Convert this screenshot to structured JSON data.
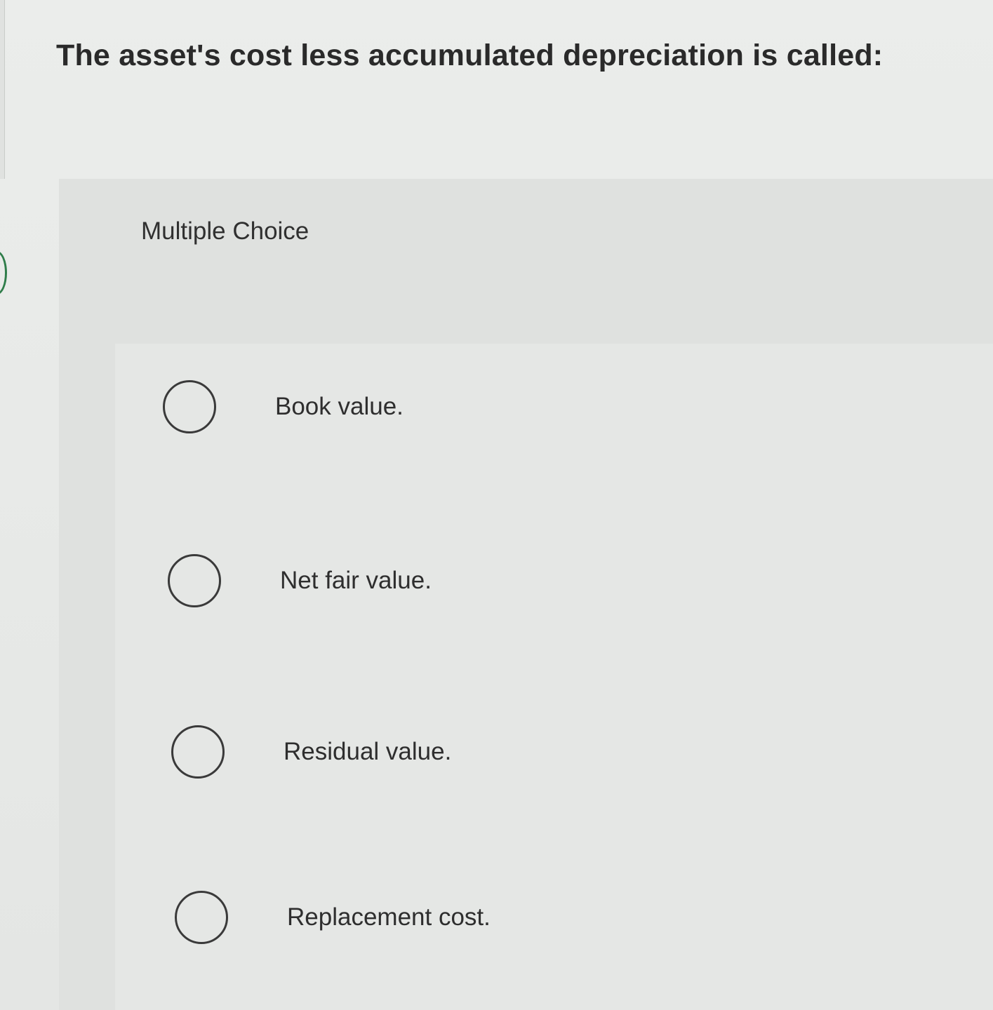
{
  "question": {
    "text": "The asset's cost less accumulated depreciation is called:"
  },
  "panel": {
    "title": "Multiple Choice"
  },
  "options": [
    {
      "label": "Book value.",
      "selected": false
    },
    {
      "label": "Net fair value.",
      "selected": false
    },
    {
      "label": "Residual value.",
      "selected": false
    },
    {
      "label": "Replacement cost.",
      "selected": false
    }
  ],
  "colors": {
    "background": "#e6e8e6",
    "panel": "#dfe1df",
    "text": "#2b2b2b",
    "tab_accent": "#2f7d4a"
  }
}
